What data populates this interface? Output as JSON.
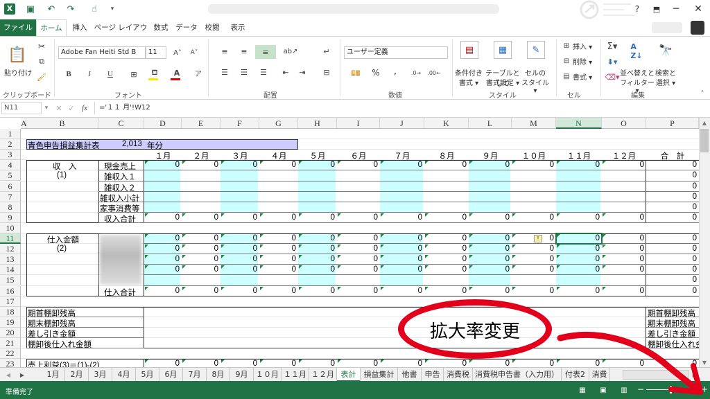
{
  "app": {
    "logo": "X"
  },
  "window": {
    "help": "?",
    "min": "─",
    "restore": "❐",
    "close": "✕"
  },
  "tabs": {
    "file": "ファイル",
    "home": "ホーム",
    "insert": "挿入",
    "layout": "ページ レイアウト",
    "formulas": "数式",
    "data": "データ",
    "review": "校閲",
    "view": "表示"
  },
  "ribbon": {
    "clipboard": {
      "paste": "貼り付け",
      "label": "クリップボード"
    },
    "font": {
      "name": "Adobe Fan Heiti Std B",
      "size": "11",
      "bold": "B",
      "italic": "I",
      "underline": "U",
      "label": "フォント"
    },
    "align": {
      "label": "配置"
    },
    "number": {
      "format": "ユーザー定義",
      "percent": "%",
      "comma": ",",
      "label": "数値"
    },
    "styles": {
      "cond1": "条件付き",
      "cond2": "書式 ▾",
      "table1": "テーブルとして",
      "table2": "書式設定 ▾",
      "cell1": "セルの",
      "cell2": "スタイル ▾",
      "label": "スタイル"
    },
    "cells": {
      "insert": "挿入 ▾",
      "delete": "削除 ▾",
      "format": "書式 ▾",
      "label": "セル"
    },
    "edit": {
      "sort1": "並べ替えと",
      "sort2": "フィルター ▾",
      "find1": "検索と",
      "find2": "選択 ▾",
      "label": "編集"
    }
  },
  "formula": {
    "namebox": "N11",
    "fx": "fx",
    "content": "='１１ 月'!W12"
  },
  "columns": [
    "A",
    "B",
    "C",
    "D",
    "E",
    "F",
    "G",
    "H",
    "I",
    "J",
    "K",
    "L",
    "M",
    "N",
    "O",
    "P"
  ],
  "rows": [
    "1",
    "2",
    "3",
    "4",
    "5",
    "6",
    "7",
    "8",
    "9",
    "10",
    "11",
    "12",
    "13",
    "14",
    "15",
    "16",
    "17",
    "18",
    "19",
    "20",
    "21",
    "22",
    "23"
  ],
  "sheet": {
    "title": "青色申告損益集計表",
    "year": "2,013",
    "year_unit": "年分",
    "months": [
      "１月",
      "２月",
      "３月",
      "４月",
      "５月",
      "６月",
      "７月",
      "８月",
      "９月",
      "１０月",
      "１１月",
      "１２月",
      "合　計"
    ],
    "income_label": "収　入",
    "income_no": "(1)",
    "income_rows": [
      "現金売上",
      "雑収入１",
      "雑収入２",
      "雑収入小計",
      "家事消費等",
      "収入合計"
    ],
    "purchase_label": "仕入金額",
    "purchase_no": "(2)",
    "purchase_total": "仕入合計",
    "inv_rows": [
      "期首棚卸残高",
      "期末棚卸残高",
      "差し引き金額",
      "棚卸後仕入れ金額"
    ],
    "inv_rows_right": [
      "期首棚卸残高",
      "期末棚卸残高",
      "差し引き金額",
      "棚卸後仕入れ金"
    ],
    "gross": "売上利益(3)＝(1)-(2)",
    "zero": "0"
  },
  "sheet_tabs": [
    "1月",
    "2月",
    "3月",
    "4月",
    "5月",
    "6月",
    "7月",
    "8月",
    "9月",
    "１０月",
    "１１月",
    "１２月",
    "表計",
    "損益集計",
    "他書",
    "申告",
    "消費税",
    "消費税申告書（入力用）",
    "付表2",
    "消費"
  ],
  "status": {
    "ready": "準備完了"
  },
  "annotation": {
    "text": "拡大率変更",
    "color": "#e2001a"
  }
}
